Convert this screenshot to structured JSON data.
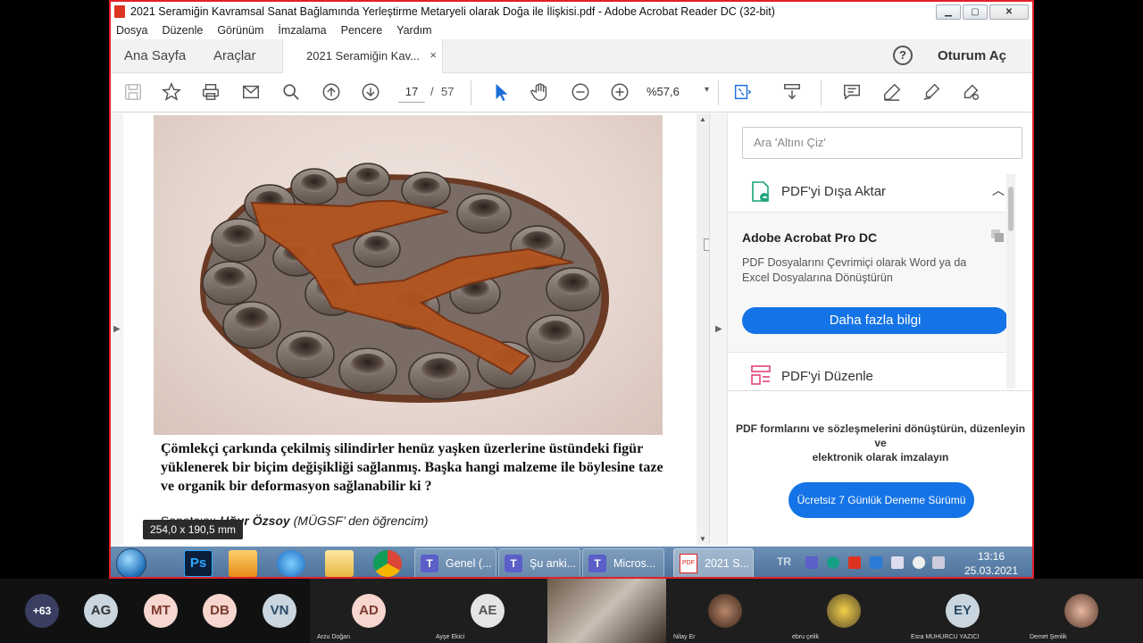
{
  "window": {
    "title": "2021 Seramiğin Kavramsal Sanat Bağlamında Yerleştirme  Metaryeli olarak Doğa ile İlişkisi.pdf - Adobe Acrobat Reader DC (32-bit)",
    "minimize": "▁",
    "maximize": "▢",
    "close": "✕"
  },
  "menu": [
    "Dosya",
    "Düzenle",
    "Görünüm",
    "İmzalama",
    "Pencere",
    "Yardım"
  ],
  "tabs": {
    "home": "Ana Sayfa",
    "tools": "Araçlar",
    "doc": "2021 Seramiğin Kav...",
    "close": "×",
    "help": "?",
    "signin": "Oturum Aç"
  },
  "toolbar": {
    "page_current": "17",
    "page_sep": "/",
    "page_total": "57",
    "zoom": "%57,6",
    "zoom_caret": "▾"
  },
  "document": {
    "caption": "Çömlekçi çarkında  çekilmiş silindirler  henüz yaşken  üzerlerine üstündeki  figür yüklenerek  bir biçim değişikliği sağlanmış.  Başka hangi malzeme ile  böylesine taze ve organik  bir deformasyon  sağlanabilir ki ?",
    "credit_prefix": "Sanatçısı:",
    "credit_name": "Uğur  Özsoy",
    "credit_note": "(MÜGSF’ den öğrencim)",
    "tooltip": "254,0 x 190,5 mm"
  },
  "right_panel": {
    "search_placeholder": "Ara 'Altını Çiz'",
    "export_label": "PDF'yi Dışa Aktar",
    "export_chevron": "︿",
    "promo_title": "Adobe Acrobat Pro DC",
    "promo_desc": "PDF Dosyalarını Çevrimiçi olarak Word ya da Excel Dosyalarına Dönüştürün",
    "promo_button": "Daha fazla bilgi",
    "edit_label": "PDF'yi Düzenle",
    "bottom_line1": "PDF formlarını ve sözleşmelerini dönüştürün, düzenleyin",
    "bottom_line2": "ve",
    "bottom_line3": "elektronik olarak imzalayın",
    "trial_button": "Ücretsiz 7 Günlük Deneme Sürümü"
  },
  "taskbar": {
    "items": [
      {
        "label": "Genel (...",
        "icon": "T"
      },
      {
        "label": "Şu anki...",
        "icon": "T"
      },
      {
        "label": "Micros...",
        "icon": "T"
      },
      {
        "label": "2021 S...",
        "icon": "PDF"
      }
    ],
    "ps_label": "Ps",
    "lang": "TR",
    "time": "13:16",
    "date": "25.03.2021"
  },
  "participants": {
    "more": "+63",
    "initials": [
      "AG",
      "MT",
      "DB",
      "VN"
    ],
    "tiles": [
      {
        "initials": "AD",
        "name": "Arzu Doğan"
      },
      {
        "initials": "AE",
        "name": "Ayşe Ekici"
      },
      {
        "initials": "",
        "name": ""
      },
      {
        "initials": "",
        "name": "Nilay Er"
      },
      {
        "initials": "",
        "name": "ebru çelik"
      },
      {
        "initials": "EY",
        "name": "Esra MUHURCU YAZICI"
      },
      {
        "initials": "",
        "name": "Demet Şenlik"
      }
    ]
  },
  "colors": {
    "accent_blue": "#1473e6",
    "window_border": "#e0202a",
    "teams": "#5b5fc7"
  }
}
